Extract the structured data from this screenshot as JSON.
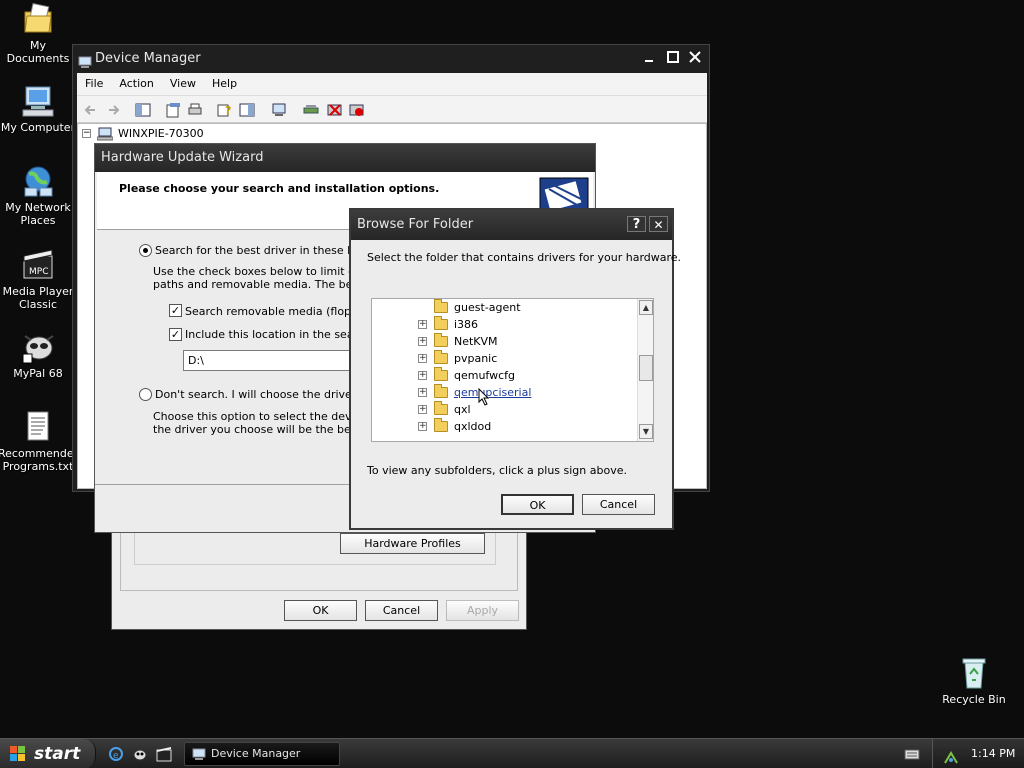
{
  "desktop": {
    "icons": [
      {
        "label": "My Documents"
      },
      {
        "label": "My Computer"
      },
      {
        "label": "My Network Places"
      },
      {
        "label": "Media Player Classic"
      },
      {
        "label": "MyPal 68"
      },
      {
        "label": "Recommended Programs.txt"
      },
      {
        "label": "Recycle Bin"
      }
    ]
  },
  "device_manager": {
    "title": "Device Manager",
    "menu": [
      "File",
      "Action",
      "View",
      "Help"
    ],
    "tree_root": "WINXPIE-70300"
  },
  "properties": {
    "hardware_profiles_label": "Hardware Profiles",
    "ok_label": "OK",
    "cancel_label": "Cancel",
    "apply_label": "Apply"
  },
  "wizard": {
    "title": "Hardware Update Wizard",
    "header": "Please choose your search and installation options.",
    "search_option": "Search for the best driver in these locations.",
    "search_desc_1": "Use the check boxes below to limit or expand the default search, which includes local",
    "search_desc_2": "paths and removable media. The best driver found will be installed.",
    "check_removable": "Search removable media (floppy, CD-ROM...)",
    "check_include": "Include this location in the search:",
    "location_value": "D:\\",
    "dont_search_option": "Don't search. I will choose the driver to install.",
    "dont_desc_1": "Choose this option to select the device driver from a list. Windows does not guarantee that",
    "dont_desc_2": "the driver you choose will be the best match for your hardware."
  },
  "browse": {
    "title": "Browse For Folder",
    "help_label": "?",
    "close_label": "✕",
    "instruction": "Select the folder that contains drivers for your hardware.",
    "folders": [
      {
        "name": "guest-agent",
        "expandable": false,
        "selected": false
      },
      {
        "name": "i386",
        "expandable": true,
        "selected": false
      },
      {
        "name": "NetKVM",
        "expandable": true,
        "selected": false
      },
      {
        "name": "pvpanic",
        "expandable": true,
        "selected": false
      },
      {
        "name": "qemufwcfg",
        "expandable": true,
        "selected": false
      },
      {
        "name": "qemupciserial",
        "expandable": true,
        "selected": true
      },
      {
        "name": "qxl",
        "expandable": true,
        "selected": false
      },
      {
        "name": "qxldod",
        "expandable": true,
        "selected": false
      }
    ],
    "hint": "To view any subfolders, click a plus sign above.",
    "ok_label": "OK",
    "cancel_label": "Cancel"
  },
  "taskbar": {
    "start_label": "start",
    "task_label": "Device Manager",
    "clock": "1:14 PM"
  },
  "colors": {
    "desktop_bg": "#0c0c0c",
    "titlebar": "#2e2e2e",
    "window_face": "#ececec",
    "selection_link": "#1a3b9c",
    "folder_yellow": "#f2cf5c"
  }
}
